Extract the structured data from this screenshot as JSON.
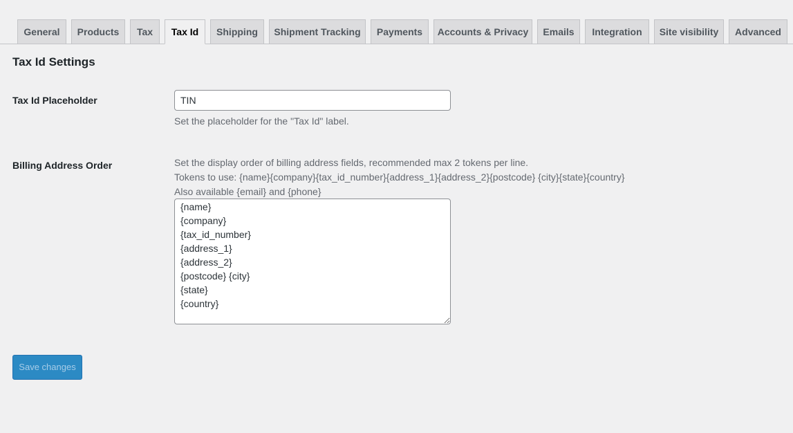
{
  "tabs": [
    {
      "label": "General",
      "active": false
    },
    {
      "label": "Products",
      "active": false
    },
    {
      "label": "Tax",
      "active": false
    },
    {
      "label": "Tax Id",
      "active": true
    },
    {
      "label": "Shipping",
      "active": false
    },
    {
      "label": "Shipment Tracking",
      "active": false
    },
    {
      "label": "Payments",
      "active": false
    },
    {
      "label": "Accounts & Privacy",
      "active": false
    },
    {
      "label": "Emails",
      "active": false
    },
    {
      "label": "Integration",
      "active": false
    },
    {
      "label": "Site visibility",
      "active": false
    },
    {
      "label": "Advanced",
      "active": false
    }
  ],
  "section": {
    "title": "Tax Id Settings"
  },
  "tax_id_placeholder": {
    "label": "Tax Id Placeholder",
    "value": "TIN",
    "description": "Set the placeholder for the \"Tax Id\" label."
  },
  "billing_address_order": {
    "label": "Billing Address Order",
    "description_line1": "Set the display order of billing address fields, recommended max 2 tokens per line.",
    "description_line2": "Tokens to use: {name}{company}{tax_id_number}{address_1}{address_2}{postcode} {city}{state}{country}",
    "description_line3": "Also available {email} and {phone}",
    "value": "{name}\n{company}\n{tax_id_number}\n{address_1}\n{address_2}\n{postcode} {city}\n{state}\n{country}"
  },
  "save_button": {
    "label": "Save changes"
  },
  "colors": {
    "background": "#f0f0f1",
    "tab_inactive": "#dcdcde",
    "button_primary": "#2c8ac4"
  }
}
